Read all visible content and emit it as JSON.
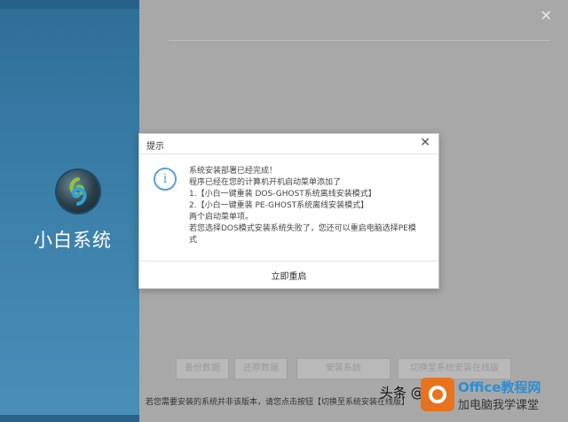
{
  "app": {
    "brand": "小白系统",
    "window_close": "✕"
  },
  "buttons": [
    {
      "label": "备份数据"
    },
    {
      "label": "还原数据"
    },
    {
      "label": "安装系统"
    },
    {
      "label": "切换至系统安装在线版"
    }
  ],
  "notice": "若您需要安装的系统并非该版本，请您点击按钮【切换至系统安装在线版】",
  "watermark": {
    "text": "头条 @",
    "office_title": "Office教程网",
    "office_sub": "加电脑我学课堂",
    "office_color": "#e8731f"
  },
  "dialog": {
    "title": "提示",
    "close": "✕",
    "messages": [
      "系统安装部署已经完成！",
      "程序已经在您的计算机开机启动菜单添加了",
      "1.【小白一键重装 DOS-GHOST系统离线安装模式】",
      "2.【小白一键重装 PE-GHOST系统离线安装模式】",
      "两个启动菜单项。",
      "若您选择DOS模式安装系统失败了，您还可以重启电脑选择PE模式"
    ],
    "restart_label": "立即重启",
    "accent": "#5aa0d8"
  }
}
